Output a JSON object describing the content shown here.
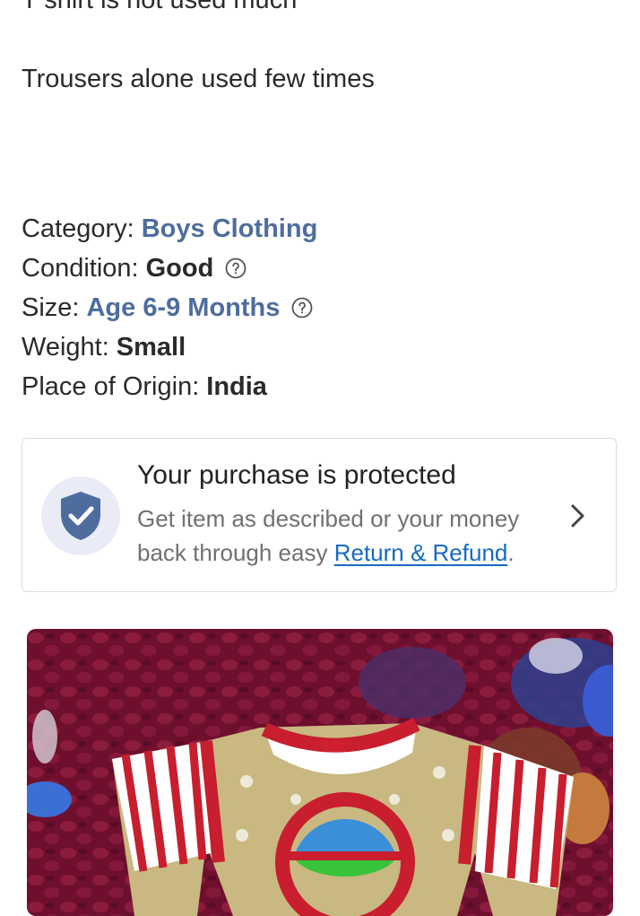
{
  "description": {
    "line1": "T shirt is not used much",
    "line2": "Trousers alone used few times"
  },
  "attributes": {
    "category_label": "Category:",
    "category_value": "Boys Clothing",
    "condition_label": "Condition:",
    "condition_value": "Good",
    "size_label": "Size:",
    "size_value": "Age 6-9 Months",
    "weight_label": "Weight:",
    "weight_value": "Small",
    "origin_label": "Place of Origin:",
    "origin_value": "India"
  },
  "protection": {
    "title": "Your purchase is protected",
    "subtitle": "Get item as described or your money back through easy ",
    "link": "Return & Refund",
    "period": "."
  },
  "colors": {
    "link_value": "#4e6d9e",
    "refund_link": "#1769c3",
    "shield": "#4e6d9e",
    "shield_bg": "#e9ecf7"
  },
  "icons": {
    "help": "question-circle-icon",
    "shield": "shield-check-icon",
    "chevron": "chevron-right-icon"
  }
}
